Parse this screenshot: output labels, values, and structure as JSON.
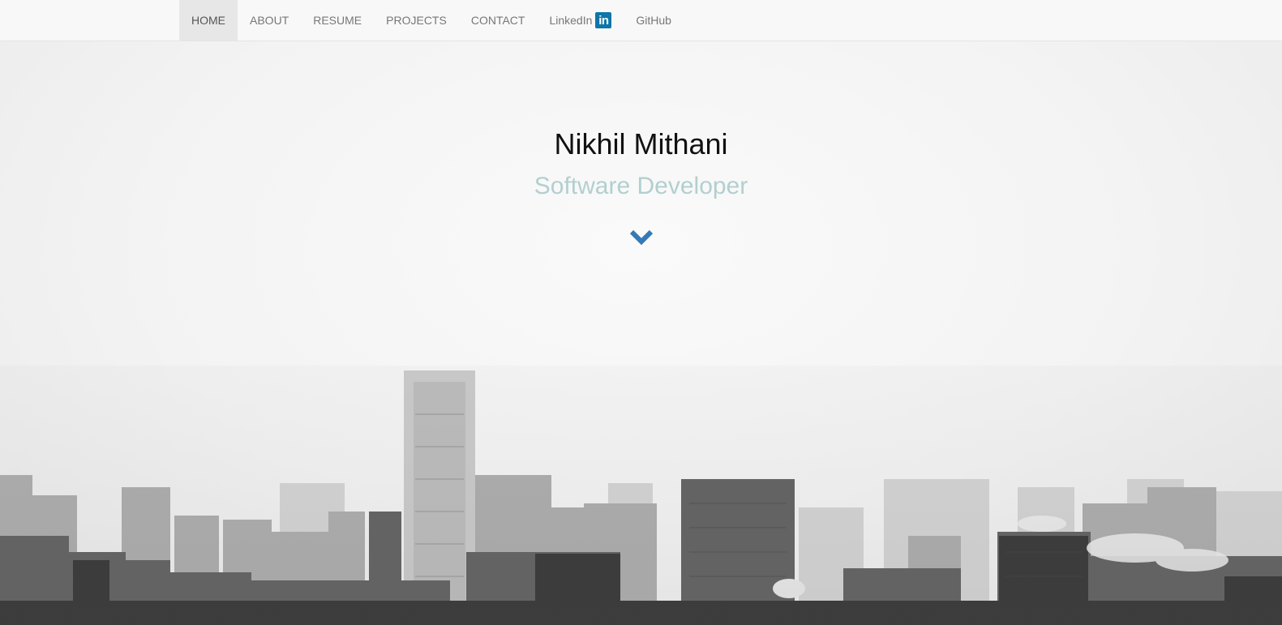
{
  "nav": {
    "items": [
      {
        "label": "HOME",
        "active": true
      },
      {
        "label": "ABOUT"
      },
      {
        "label": "RESUME"
      },
      {
        "label": "PROJECTS"
      },
      {
        "label": "CONTACT"
      }
    ],
    "linkedin": {
      "label": "LinkedIn",
      "badge": "in",
      "badge_color": "#0e76a8"
    },
    "github": {
      "label": "GitHub"
    }
  },
  "hero": {
    "name": "Nikhil Mithani",
    "role": "Software Developer",
    "scroll_icon": "chevron-down-icon",
    "accent": "#337ab7"
  }
}
